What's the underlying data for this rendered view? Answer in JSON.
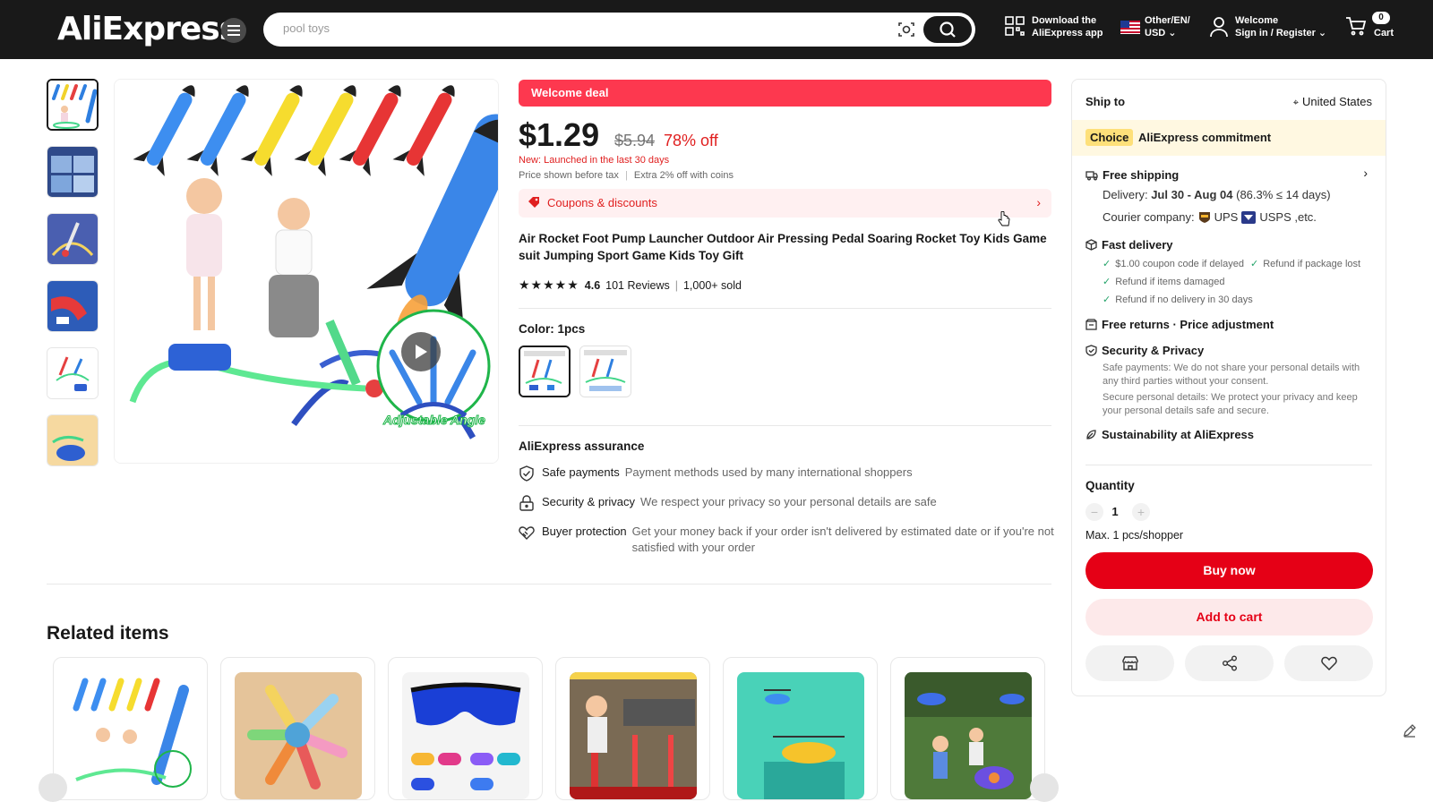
{
  "header": {
    "logo": "AliExpress",
    "search_placeholder": "pool toys",
    "download_line1": "Download the",
    "download_line2": "AliExpress app",
    "locale_line1": "Other/EN/",
    "locale_line2": "USD",
    "welcome_line1": "Welcome",
    "welcome_line2": "Sign in / Register",
    "cart_count": "0",
    "cart_label": "Cart"
  },
  "product": {
    "welcome_deal": "Welcome deal",
    "price": "$1.29",
    "old_price": "$5.94",
    "discount": "78% off",
    "new_launch": "New: Launched in the last 30 days",
    "tax_note": "Price shown before tax",
    "coins_note": "Extra 2% off with coins",
    "coupons": "Coupons & discounts",
    "title": "Air Rocket Foot Pump Launcher Outdoor Air Pressing Pedal Soaring Rocket Toy Kids Game suit Jumping Sport Game Kids Toy Gift",
    "rating": "4.6",
    "reviews": "101 Reviews",
    "sold": "1,000+ sold",
    "color_label": "Color: 1pcs",
    "image_caption": "Adjustable Angle"
  },
  "assurance": {
    "title": "AliExpress assurance",
    "items": [
      {
        "name": "Safe payments",
        "desc": "Payment methods used by many international shoppers"
      },
      {
        "name": "Security & privacy",
        "desc": "We respect your privacy so your personal details are safe"
      },
      {
        "name": "Buyer protection",
        "desc": "Get your money back if your order isn't delivered by estimated date or if you're not satisfied with your order"
      }
    ]
  },
  "related": {
    "title": "Related items"
  },
  "panel": {
    "ship_to": "Ship to",
    "country": "United States",
    "choice_badge": "Choice",
    "commitment": "AliExpress commitment",
    "free_shipping": "Free shipping",
    "delivery_label": "Delivery:",
    "delivery_dates": "Jul 30 - Aug 04",
    "delivery_rate": "(86.3% ≤ 14 days)",
    "courier_label": "Courier company:",
    "courier_ups": "UPS",
    "courier_usps": "USPS ,etc.",
    "fast_delivery": "Fast delivery",
    "checks": [
      "$1.00 coupon code if delayed",
      "Refund if package lost",
      "Refund if items damaged",
      "Refund if no delivery in 30 days"
    ],
    "free_returns": "Free returns · Price adjustment",
    "security_title": "Security & Privacy",
    "security_desc1": "Safe payments: We do not share your personal details with any third parties without your consent.",
    "security_desc2": "Secure personal details: We protect your privacy and keep your personal details safe and secure.",
    "sustainability": "Sustainability at AliExpress",
    "quantity_label": "Quantity",
    "quantity": "1",
    "max_note": "Max. 1 pcs/shopper",
    "buy_now": "Buy now",
    "add_to_cart": "Add to cart"
  },
  "colors": {
    "header_bg": "#191919",
    "deal_red": "#fd384f",
    "buy_red": "#e50016",
    "price_red": "#e02020",
    "choice_yellow": "#fee07a"
  }
}
